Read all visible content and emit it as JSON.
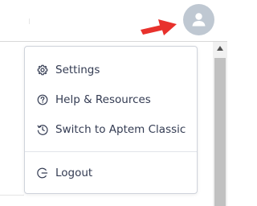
{
  "header": {
    "avatar_icon": "user-avatar-icon"
  },
  "annotation": {
    "arrow_color": "#e8312c"
  },
  "menu": {
    "items": [
      {
        "label": "Settings",
        "icon": "gear-icon"
      },
      {
        "label": "Help & Resources",
        "icon": "help-circle-icon"
      },
      {
        "label": "Switch to Aptem Classic",
        "icon": "history-clock-icon"
      }
    ],
    "logout": {
      "label": "Logout",
      "icon": "logout-icon"
    }
  },
  "colors": {
    "menu_text": "#333b52",
    "menu_border": "#cfd3db",
    "avatar_bg": "#bfc8d2"
  }
}
